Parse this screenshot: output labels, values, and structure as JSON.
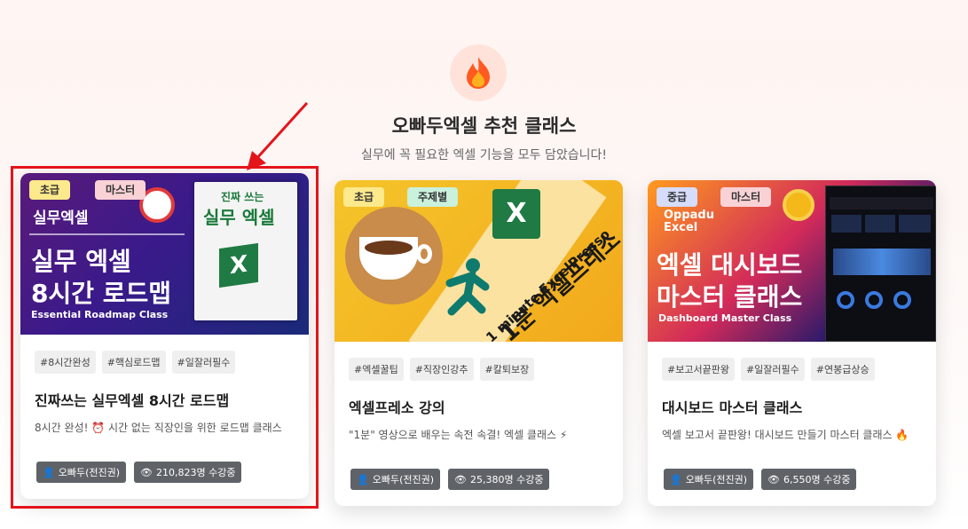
{
  "section": {
    "title": "오빠두엑셀 추천 클래스",
    "subtitle": "실무에 꼭 필요한 엑셀 기능을 모두 담았습니다!",
    "icon": "fire-icon"
  },
  "cards": [
    {
      "badges": [
        "초급",
        "마스터"
      ],
      "thumb": {
        "line1": "실무 엑셀",
        "line2": "8시간 로드맵",
        "line3": "Essential Roadmap Class",
        "corner": "실무엑셀",
        "book_title": "실무 엑셀",
        "book_top": "진짜 쓰는"
      },
      "hashtags": [
        "#8시간완성",
        "#핵심로드맵",
        "#일잘러필수"
      ],
      "title": "진짜쓰는 실무엑셀 8시간 로드맵",
      "desc": "8시간 완성! ⏰ 시간 없는 직장인을 위한 로드맵 클래스",
      "author": "오빠두(전진권)",
      "students": "210,823명 수강중"
    },
    {
      "badges": [
        "초급",
        "주제별"
      ],
      "thumb": {
        "line1": "1 minute ExcelPresso",
        "line2": "1분 엑셀프레소"
      },
      "hashtags": [
        "#엑셀꿀팁",
        "#직장인강추",
        "#칼퇴보장"
      ],
      "title": "엑셀프레소 강의",
      "desc": "\"1분\" 영상으로 배우는 속전 속결! 엑셀 클래스 ⚡",
      "author": "오빠두(전진권)",
      "students": "25,380명 수강중"
    },
    {
      "badges": [
        "중급",
        "마스터"
      ],
      "thumb": {
        "brand1": "Oppadu",
        "brand2": "Excel",
        "line1": "엑셀 대시보드",
        "line2": "마스터 클래스",
        "line3": "Dashboard Master Class"
      },
      "hashtags": [
        "#보고서끝판왕",
        "#일잘러필수",
        "#연봉급상승"
      ],
      "title": "대시보드 마스터 클래스",
      "desc": "엑셀 보고서 끝판왕! 대시보드 만들기 마스터 클래스 🔥",
      "author": "오빠두(전진권)",
      "students": "6,550명 수강중"
    }
  ],
  "colors": {
    "badge_beginner": "#fbe98b",
    "badge_master": "#f9d2d6",
    "badge_topic": "#c9f1dc",
    "badge_intermediate": "#d6dcfb",
    "highlight": "#e4141b"
  }
}
